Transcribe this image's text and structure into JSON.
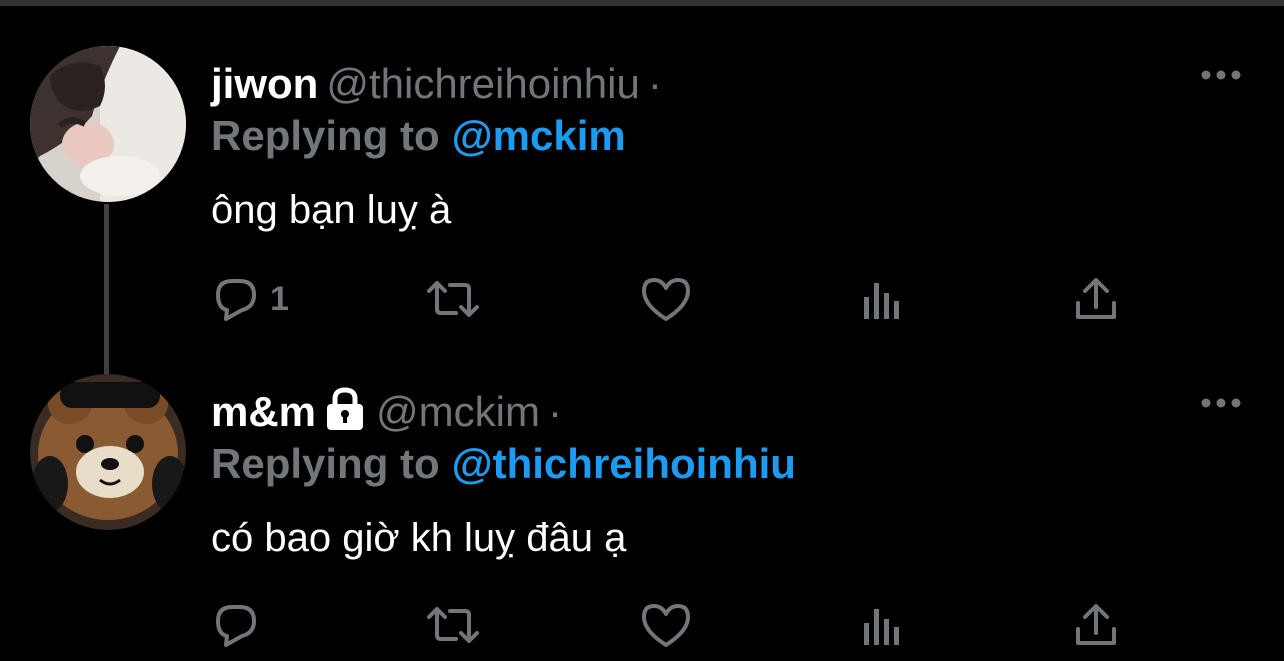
{
  "tweets": [
    {
      "name": "jiwon",
      "handle": "@thichreihoinhiu",
      "separator": "·",
      "replying_label": "Replying to",
      "replying_to": "@mckim",
      "text": "ông bạn luỵ à",
      "reply_count": "1",
      "protected": false
    },
    {
      "name": "m&m",
      "handle": "@mckim",
      "separator": "·",
      "replying_label": "Replying to",
      "replying_to": "@thichreihoinhiu",
      "text": "có bao giờ kh luỵ đâu ạ",
      "reply_count": "",
      "protected": true
    }
  ],
  "icons": {
    "reply": "reply-icon",
    "retweet": "retweet-icon",
    "like": "heart-icon",
    "views": "views-icon",
    "share": "share-icon",
    "more": "more-icon",
    "lock": "lock-icon"
  },
  "colors": {
    "background": "#000000",
    "text": "#ffffff",
    "secondary": "#71767b",
    "accent": "#1d9bf0",
    "thread_line": "#3e4144"
  }
}
